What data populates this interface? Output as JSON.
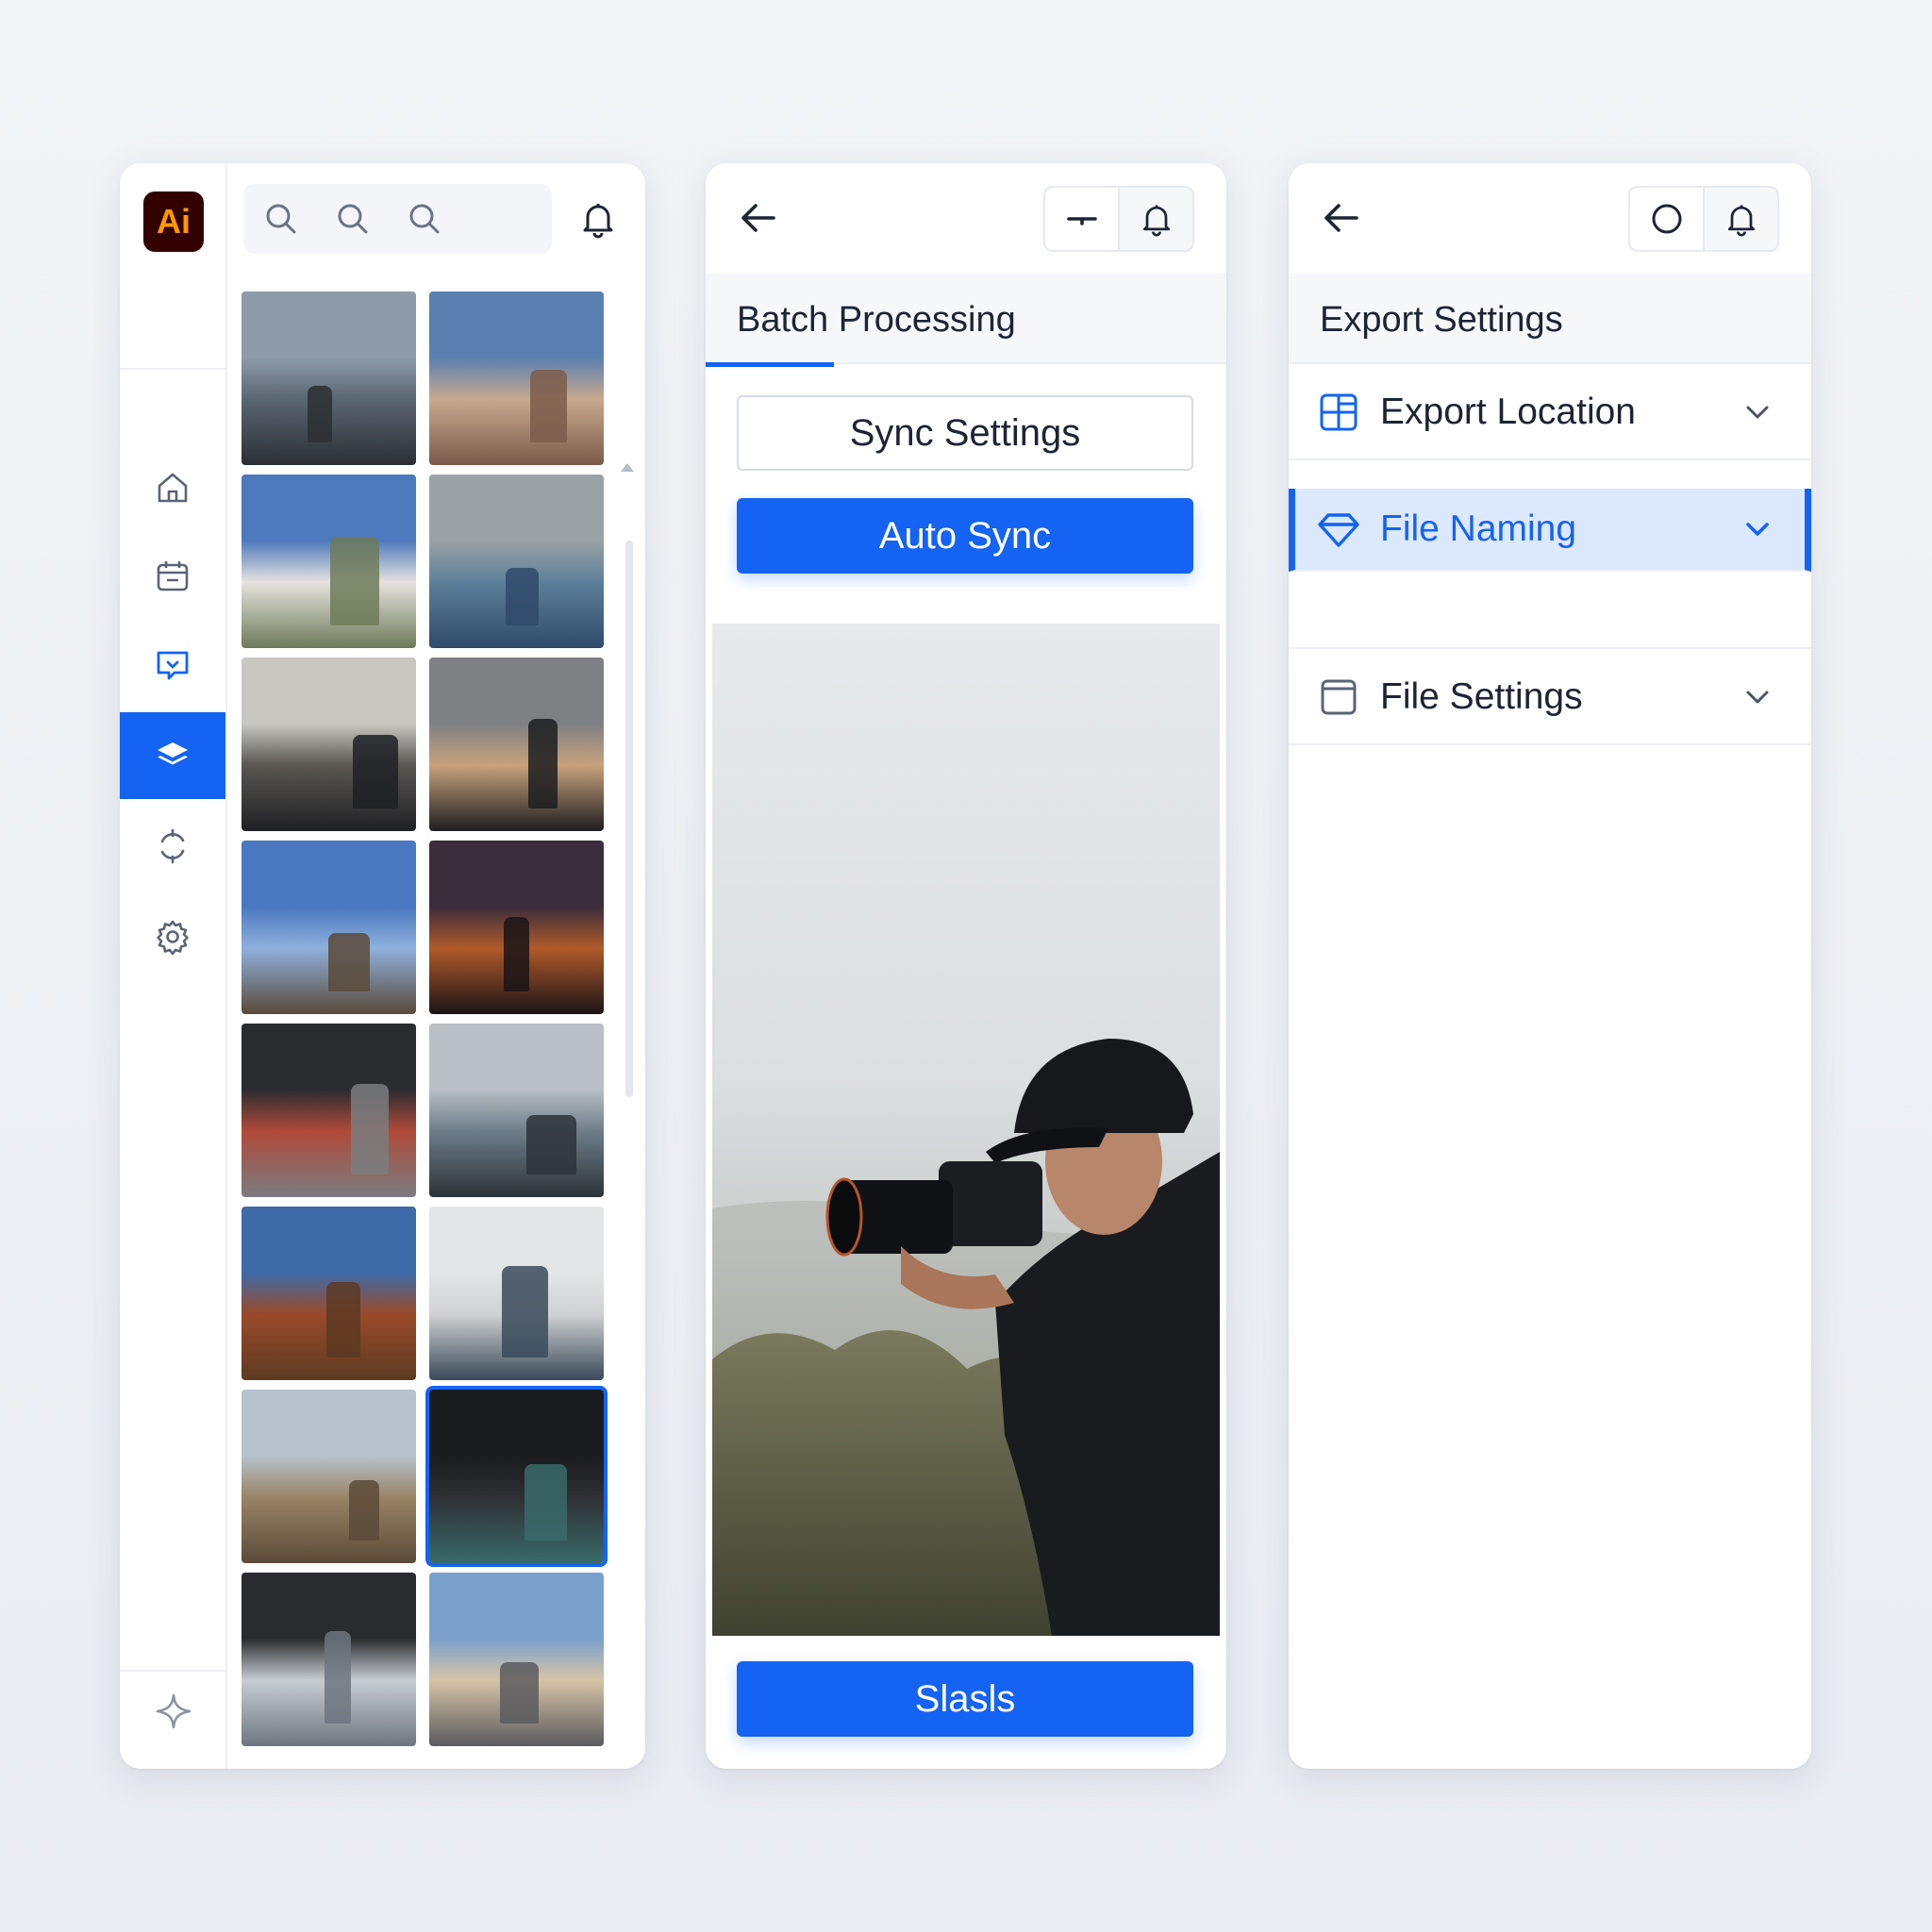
{
  "library": {
    "app_logo_text": "Ai",
    "rail_items": [
      "home-icon",
      "calendar-icon",
      "chat-icon",
      "layers-icon",
      "sync-icon",
      "settings-icon"
    ],
    "active_rail_item": "layers-icon",
    "search_icons": [
      "search-icon",
      "search-icon",
      "search-icon"
    ],
    "bell_icon": "bell-icon",
    "bottom_icon": "sparkle-icon",
    "thumbnails": [
      {
        "subject": "person on lake shore",
        "colors": [
          "#8e9ba8",
          "#5b6673",
          "#2b2f33"
        ]
      },
      {
        "subject": "old town buildings",
        "colors": [
          "#5a7fb0",
          "#c8a98e",
          "#7b5a4a"
        ]
      },
      {
        "subject": "apartment building",
        "colors": [
          "#4e79bd",
          "#e6e3de",
          "#6e7a5a"
        ]
      },
      {
        "subject": "traveler with backpack on street",
        "colors": [
          "#9aa2a5",
          "#5d7f9a",
          "#2f4a6a"
        ]
      },
      {
        "subject": "photographer with camera",
        "colors": [
          "#c9c7c2",
          "#5a5752",
          "#1f2024"
        ]
      },
      {
        "subject": "portrait in black hat",
        "colors": [
          "#7e8084",
          "#c8a27c",
          "#1c1d20"
        ]
      },
      {
        "subject": "eiffel tower",
        "colors": [
          "#4a78c0",
          "#8fb0dc",
          "#5a4a3a"
        ]
      },
      {
        "subject": "sunset silhouette",
        "colors": [
          "#3b2d3b",
          "#b05a2a",
          "#1a1416"
        ]
      },
      {
        "subject": "city street person",
        "colors": [
          "#2a2c30",
          "#b04a3a",
          "#7a7c80"
        ]
      },
      {
        "subject": "person walking in sea",
        "colors": [
          "#b9bfc4",
          "#6d7d8a",
          "#2d3338"
        ]
      },
      {
        "subject": "chinese temple",
        "colors": [
          "#3e6aa8",
          "#9a4a2a",
          "#5c3a22"
        ]
      },
      {
        "subject": "hiker in snow",
        "colors": [
          "#e4e5e6",
          "#cfd1d2",
          "#3a4a5a"
        ]
      },
      {
        "subject": "person in field",
        "colors": [
          "#b7c2cc",
          "#9a8466",
          "#5a4a38"
        ]
      },
      {
        "subject": "camera body closeup",
        "colors": [
          "#1a1b1e",
          "#2e3034",
          "#3a6a6a"
        ]
      },
      {
        "subject": "framed person at lake",
        "colors": [
          "#2a2b2e",
          "#c8cdd2",
          "#6d7680"
        ]
      },
      {
        "subject": "european street with tower",
        "colors": [
          "#7aa0cc",
          "#d6c4a6",
          "#5a5a5e"
        ]
      }
    ],
    "selected_thumbnail_index": 13
  },
  "batch": {
    "back_icon": "arrow-left-icon",
    "header_icons": [
      "minus-icon",
      "bell-icon"
    ],
    "section_title": "Batch Processing",
    "sync_settings_label": "Sync Settings",
    "auto_sync_label": "Auto Sync",
    "preview_subject": "photographer with camera",
    "bottom_button_label": "Slasls",
    "accent_color": "#1463f3"
  },
  "export": {
    "back_icon": "arrow-left-icon",
    "header_icons": [
      "circle-icon",
      "bell-icon"
    ],
    "section_title": "Export Settings",
    "rows": [
      {
        "label": "Export Location",
        "icon": "grid-icon",
        "expanded": false
      },
      {
        "label": "File Naming",
        "icon": "diamond-icon",
        "expanded": true
      },
      {
        "label": "File Settings",
        "icon": "file-icon",
        "expanded": false
      }
    ]
  }
}
